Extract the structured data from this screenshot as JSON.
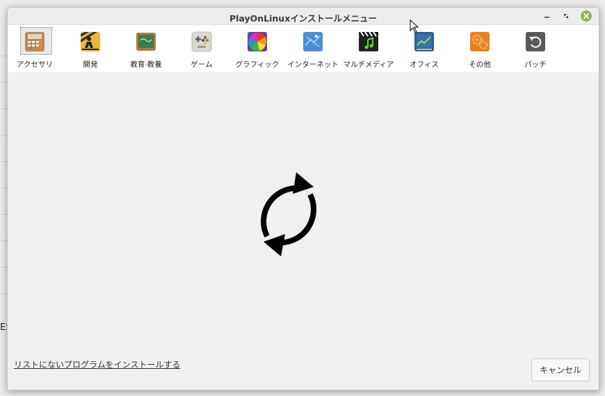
{
  "window": {
    "title": "PlayOnLinuxインストールメニュー"
  },
  "background": {
    "edge_text": "ES"
  },
  "categories": [
    {
      "label": "アクセサリ",
      "icon": "accessories-calculator-icon",
      "selected": true
    },
    {
      "label": "開発",
      "icon": "development-construction-icon"
    },
    {
      "label": "教育·教養",
      "icon": "education-chalkboard-icon"
    },
    {
      "label": "ゲーム",
      "icon": "games-gamepad-icon"
    },
    {
      "label": "グラフィック",
      "icon": "graphics-color-wheel-icon"
    },
    {
      "label": "インターネット",
      "icon": "internet-globe-icon"
    },
    {
      "label": "マルチメディア",
      "icon": "multimedia-clapper-icon"
    },
    {
      "label": "オフィス",
      "icon": "office-chart-icon"
    },
    {
      "label": "その他",
      "icon": "other-gears-icon"
    },
    {
      "label": "パッチ",
      "icon": "patch-restore-icon"
    }
  ],
  "main": {
    "loading_icon": "refresh-icon"
  },
  "footer": {
    "install_link": "リストにないプログラムをインストールする",
    "cancel_label": "キャンセル"
  },
  "colors": {
    "close_button": "#8fb35d"
  }
}
